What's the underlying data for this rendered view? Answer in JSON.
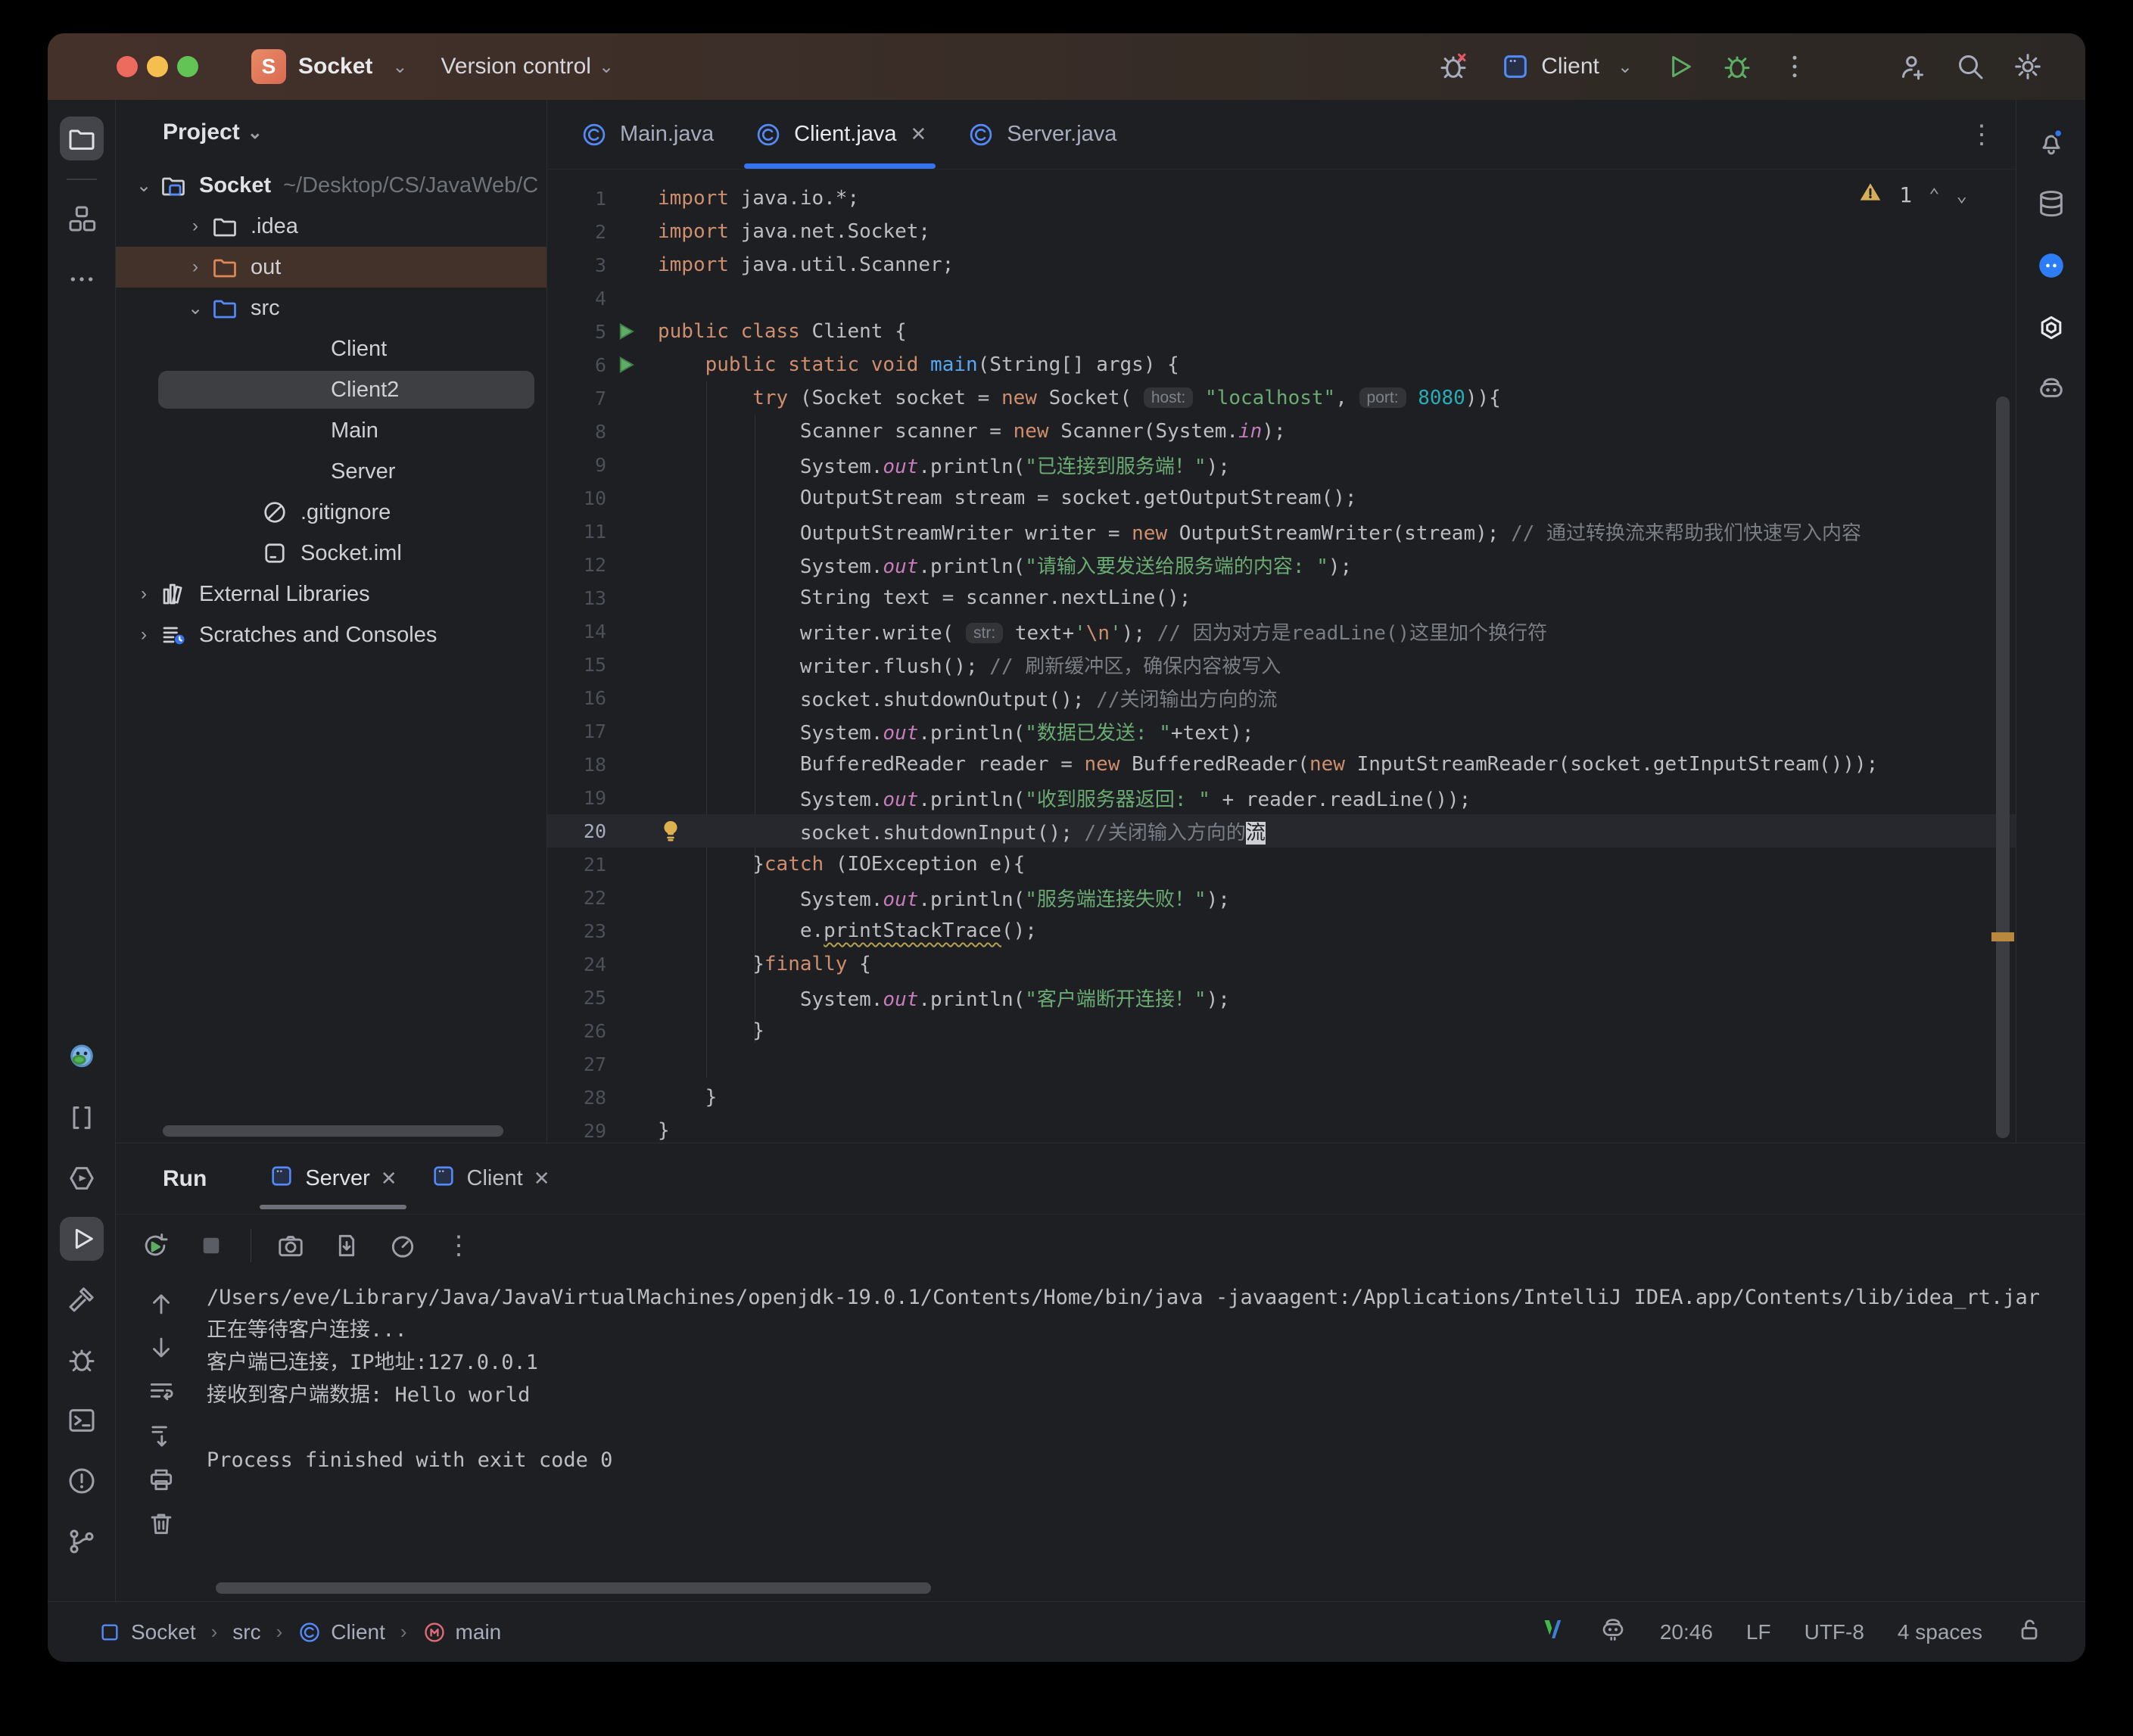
{
  "titlebar": {
    "project_badge": "S",
    "project_name": "Socket",
    "vcs_label": "Version control",
    "run_config": "Client"
  },
  "project_panel": {
    "header": "Project",
    "tree": [
      {
        "chevron": "down",
        "icon": "folder-project",
        "label": "Socket",
        "path": "~/Desktop/CS/JavaWeb/C",
        "bold": true,
        "pad": 18
      },
      {
        "chevron": "right",
        "icon": "folder",
        "label": ".idea",
        "pad": 86
      },
      {
        "chevron": "right",
        "icon": "folder-excluded",
        "label": "out",
        "pad": 86,
        "excluded": true
      },
      {
        "chevron": "down",
        "icon": "folder-source",
        "label": "src",
        "pad": 86
      },
      {
        "icon": "class",
        "label": "Client",
        "pad": 192
      },
      {
        "icon": "class",
        "label": "Client2",
        "pad": 192,
        "selected": true
      },
      {
        "icon": "class",
        "label": "Main",
        "pad": 192
      },
      {
        "icon": "class",
        "label": "Server",
        "pad": 192
      },
      {
        "icon": "ignored",
        "label": ".gitignore",
        "pad": 152
      },
      {
        "icon": "iml",
        "label": "Socket.iml",
        "pad": 152
      },
      {
        "chevron": "right",
        "icon": "libraries",
        "label": "External Libraries",
        "pad": 18
      },
      {
        "chevron": "right",
        "icon": "scratches",
        "label": "Scratches and Consoles",
        "pad": 18
      }
    ]
  },
  "editor": {
    "tabs": [
      {
        "label": "Main.java",
        "active": false,
        "close": false
      },
      {
        "label": "Client.java",
        "active": true,
        "close": true
      },
      {
        "label": "Server.java",
        "active": false,
        "close": false
      }
    ],
    "inspection_warning_count": "1",
    "lines": [
      {
        "n": 1,
        "segs": [
          [
            "k",
            "import"
          ],
          [
            "t",
            " java.io.*;"
          ]
        ]
      },
      {
        "n": 2,
        "segs": [
          [
            "k",
            "import"
          ],
          [
            "t",
            " java.net.Socket;"
          ]
        ]
      },
      {
        "n": 3,
        "segs": [
          [
            "k",
            "import"
          ],
          [
            "t",
            " java.util.Scanner;"
          ]
        ]
      },
      {
        "n": 4,
        "segs": []
      },
      {
        "n": 5,
        "run": true,
        "segs": [
          [
            "k",
            "public class"
          ],
          [
            "t",
            " Client {"
          ]
        ]
      },
      {
        "n": 6,
        "run": true,
        "segs": [
          [
            "t",
            "    "
          ],
          [
            "k",
            "public static void"
          ],
          [
            "t",
            " "
          ],
          [
            "m",
            "main"
          ],
          [
            "t",
            "(String[] args) {"
          ]
        ]
      },
      {
        "n": 7,
        "segs": [
          [
            "t",
            "        "
          ],
          [
            "k",
            "try"
          ],
          [
            "t",
            " (Socket socket = "
          ],
          [
            "k",
            "new"
          ],
          [
            "t",
            " Socket( "
          ],
          [
            "h",
            "host:"
          ],
          [
            "t",
            " "
          ],
          [
            "s",
            "\"localhost\""
          ],
          [
            "t",
            ", "
          ],
          [
            "h",
            "port:"
          ],
          [
            "t",
            " "
          ],
          [
            "n8",
            "8080"
          ],
          [
            "t",
            ")){"
          ]
        ]
      },
      {
        "n": 8,
        "segs": [
          [
            "t",
            "            Scanner scanner = "
          ],
          [
            "k",
            "new"
          ],
          [
            "t",
            " Scanner(System."
          ],
          [
            "f",
            "in"
          ],
          [
            "t",
            ");"
          ]
        ]
      },
      {
        "n": 9,
        "segs": [
          [
            "t",
            "            System."
          ],
          [
            "f",
            "out"
          ],
          [
            "t",
            ".println("
          ],
          [
            "s",
            "\"已连接到服务端！\""
          ],
          [
            "t",
            ");"
          ]
        ]
      },
      {
        "n": 10,
        "segs": [
          [
            "t",
            "            OutputStream stream = socket.getOutputStream();"
          ]
        ]
      },
      {
        "n": 11,
        "segs": [
          [
            "t",
            "            OutputStreamWriter writer = "
          ],
          [
            "k",
            "new"
          ],
          [
            "t",
            " OutputStreamWriter(stream); "
          ],
          [
            "c",
            "// 通过转换流来帮助我们快速写入内容"
          ]
        ]
      },
      {
        "n": 12,
        "segs": [
          [
            "t",
            "            System."
          ],
          [
            "f",
            "out"
          ],
          [
            "t",
            ".println("
          ],
          [
            "s",
            "\"请输入要发送给服务端的内容: \""
          ],
          [
            "t",
            ");"
          ]
        ]
      },
      {
        "n": 13,
        "segs": [
          [
            "t",
            "            String text = scanner.nextLine();"
          ]
        ]
      },
      {
        "n": 14,
        "segs": [
          [
            "t",
            "            writer.write( "
          ],
          [
            "h",
            "str:"
          ],
          [
            "t",
            " text+"
          ],
          [
            "s",
            "'"
          ],
          [
            "e",
            "\\n"
          ],
          [
            "s",
            "'"
          ],
          [
            "t",
            "); "
          ],
          [
            "c",
            "// 因为对方是readLine()这里加个换行符"
          ]
        ]
      },
      {
        "n": 15,
        "segs": [
          [
            "t",
            "            writer.flush(); "
          ],
          [
            "c",
            "// 刷新缓冲区，确保内容被写入"
          ]
        ]
      },
      {
        "n": 16,
        "segs": [
          [
            "t",
            "            socket.shutdownOutput(); "
          ],
          [
            "c",
            "//关闭输出方向的流"
          ]
        ]
      },
      {
        "n": 17,
        "segs": [
          [
            "t",
            "            System."
          ],
          [
            "f",
            "out"
          ],
          [
            "t",
            ".println("
          ],
          [
            "s",
            "\"数据已发送: \""
          ],
          [
            "t",
            "+text);"
          ]
        ]
      },
      {
        "n": 18,
        "segs": [
          [
            "t",
            "            BufferedReader reader = "
          ],
          [
            "k",
            "new"
          ],
          [
            "t",
            " BufferedReader("
          ],
          [
            "k",
            "new"
          ],
          [
            "t",
            " InputStreamReader(socket.getInputStream()));"
          ]
        ]
      },
      {
        "n": 19,
        "segs": [
          [
            "t",
            "            System."
          ],
          [
            "f",
            "out"
          ],
          [
            "t",
            ".println("
          ],
          [
            "s",
            "\"收到服务器返回: \""
          ],
          [
            "t",
            " + reader.readLine());"
          ]
        ]
      },
      {
        "n": 20,
        "active": true,
        "bulb": true,
        "segs": [
          [
            "t",
            "            socket.shutdownInput(); "
          ],
          [
            "c",
            "//关闭输入方向的"
          ],
          [
            "x",
            "流"
          ]
        ]
      },
      {
        "n": 21,
        "segs": [
          [
            "t",
            "        }"
          ],
          [
            "k",
            "catch"
          ],
          [
            "t",
            " (IOException e){"
          ]
        ]
      },
      {
        "n": 22,
        "segs": [
          [
            "t",
            "            System."
          ],
          [
            "f",
            "out"
          ],
          [
            "t",
            ".println("
          ],
          [
            "s",
            "\"服务端连接失败！\""
          ],
          [
            "t",
            ");"
          ]
        ]
      },
      {
        "n": 23,
        "segs": [
          [
            "t",
            "            e."
          ],
          [
            "w",
            "printStackTrace"
          ],
          [
            "t",
            "();"
          ]
        ]
      },
      {
        "n": 24,
        "segs": [
          [
            "t",
            "        }"
          ],
          [
            "k",
            "finally"
          ],
          [
            "t",
            " {"
          ]
        ]
      },
      {
        "n": 25,
        "segs": [
          [
            "t",
            "            System."
          ],
          [
            "f",
            "out"
          ],
          [
            "t",
            ".println("
          ],
          [
            "s",
            "\"客户端断开连接！\""
          ],
          [
            "t",
            ");"
          ]
        ]
      },
      {
        "n": 26,
        "segs": [
          [
            "t",
            "        }"
          ]
        ]
      },
      {
        "n": 27,
        "segs": []
      },
      {
        "n": 28,
        "segs": [
          [
            "t",
            "    }"
          ]
        ]
      },
      {
        "n": 29,
        "segs": [
          [
            "t",
            "}"
          ]
        ]
      }
    ]
  },
  "run_panel": {
    "title": "Run",
    "tabs": [
      {
        "label": "Server",
        "active": true
      },
      {
        "label": "Client",
        "active": false
      }
    ],
    "console_lines": [
      "/Users/eve/Library/Java/JavaVirtualMachines/openjdk-19.0.1/Contents/Home/bin/java -javaagent:/Applications/IntelliJ IDEA.app/Contents/lib/idea_rt.jar",
      "正在等待客户连接...",
      "客户端已连接，IP地址:127.0.0.1",
      "接收到客户端数据: Hello world",
      "",
      "Process finished with exit code 0"
    ]
  },
  "statusbar": {
    "breadcrumbs": [
      {
        "label": "Socket",
        "icon": "module"
      },
      {
        "label": "src",
        "icon": ""
      },
      {
        "label": "Client",
        "icon": "classC"
      },
      {
        "label": "main",
        "icon": "methodM"
      }
    ],
    "caret_position": "20:46",
    "line_separator": "LF",
    "encoding": "UTF-8",
    "indent": "4 spaces"
  },
  "colors": {
    "accent_blue": "#3574f0",
    "run_green": "#5fad65",
    "warning_yellow": "#d6ae58",
    "keyword_orange": "#cf8e6d",
    "string_green": "#6aab73",
    "number_cyan": "#2aacb8",
    "field_purple": "#c77dbb",
    "method_blue": "#56a8f5",
    "excluded_row_brown": "#43322a"
  }
}
